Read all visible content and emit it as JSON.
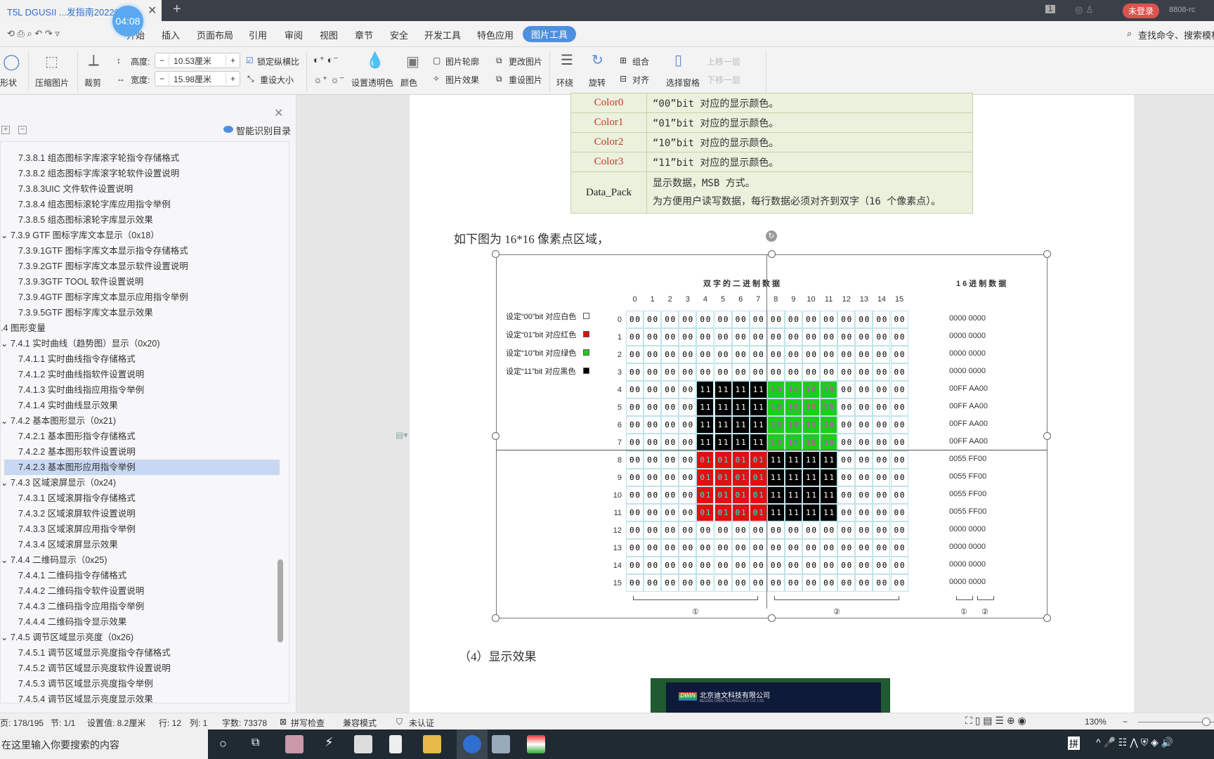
{
  "window": {
    "tab_title": "T5L DGUSII ...发指南20220",
    "timer": "04:08",
    "page_num_badge": "1",
    "login": "未登录",
    "version": "8808-rc"
  },
  "menu": {
    "items": [
      "开始",
      "插入",
      "页面布局",
      "引用",
      "审阅",
      "视图",
      "章节",
      "安全",
      "开发工具",
      "特色应用",
      "图片工具"
    ],
    "active": "图片工具",
    "search": "查找命令、搜索模板"
  },
  "ribbon": {
    "shape": "形状",
    "compress": "压缩图片",
    "crop": "裁剪",
    "height_label": "高度:",
    "height_value": "10.53厘米",
    "width_label": "宽度:",
    "width_value": "15.98厘米",
    "lock_ratio": "锁定纵横比",
    "reset_size": "重设大小",
    "transparent": "设置透明色",
    "color": "颜色",
    "outline": "图片轮廓",
    "effect": "图片效果",
    "change": "更改图片",
    "reset_pic": "重设图片",
    "wrap": "环绕",
    "rotate": "旋转",
    "group": "组合",
    "align": "对齐",
    "select_pane": "选择窗格",
    "bring_forward": "上移一层",
    "send_backward": "下移一层"
  },
  "sidebar": {
    "smart_toc": "智能识别目录",
    "items": [
      {
        "t": "7.3.8.1 组态图标字库滚字轮指令存储格式",
        "l": 2
      },
      {
        "t": "7.3.8.2 组态图标字库滚字轮软件设置说明",
        "l": 2
      },
      {
        "t": "7.3.8.3UIC 文件软件设置说明",
        "l": 2
      },
      {
        "t": "7.3.8.4 组态图标滚轮字库应用指令举例",
        "l": 2
      },
      {
        "t": "7.3.8.5 组态图标滚轮字库显示效果",
        "l": 2
      },
      {
        "t": "7.3.9 GTF 图标字库文本显示（0x18）",
        "l": 1
      },
      {
        "t": "7.3.9.1GTF 图标字库文本显示指令存储格式",
        "l": 2
      },
      {
        "t": "7.3.9.2GTF 图标字库文本显示软件设置说明",
        "l": 2
      },
      {
        "t": "7.3.9.3GTF TOOL 软件设置说明",
        "l": 2
      },
      {
        "t": "7.3.9.4GTF 图标字库文本显示应用指令举例",
        "l": 2
      },
      {
        "t": "7.3.9.5GTF 图标字库文本显示效果",
        "l": 2
      },
      {
        "t": ".4  图形变量",
        "l": 0
      },
      {
        "t": "7.4.1 实时曲线（趋势图）显示（0x20)",
        "l": 1
      },
      {
        "t": "7.4.1.1  实时曲线指令存储格式",
        "l": 2
      },
      {
        "t": "7.4.1.2 实时曲线指软件设置说明",
        "l": 2
      },
      {
        "t": "7.4.1.3 实时曲线指应用指令举例",
        "l": 2
      },
      {
        "t": "7.4.1.4 实时曲线显示效果",
        "l": 2
      },
      {
        "t": "7.4.2 基本图形显示（0x21)",
        "l": 1
      },
      {
        "t": "7.4.2.1 基本图形指令存储格式",
        "l": 2
      },
      {
        "t": "7.4.2.2 基本图形软件设置说明",
        "l": 2
      },
      {
        "t": "7.4.2.3  基本图形应用指令举例",
        "l": 2,
        "selected": true
      },
      {
        "t": "7.4.3 区域滚屏显示（0x24)",
        "l": 1
      },
      {
        "t": "7.4.3.1 区域滚屏指令存储格式",
        "l": 2
      },
      {
        "t": "7.4.3.2 区域滚屏软件设置说明",
        "l": 2
      },
      {
        "t": "7.4.3.3 区域滚屏应用指令举例",
        "l": 2
      },
      {
        "t": "7.4.3.4 区域滚屏显示效果",
        "l": 2
      },
      {
        "t": "7.4.4 二维码显示（0x25)",
        "l": 1
      },
      {
        "t": "7.4.4.1 二维码指令存储格式",
        "l": 2
      },
      {
        "t": "7.4.4.2 二维码指令软件设置说明",
        "l": 2
      },
      {
        "t": "7.4.4.3 二维码指令应用指令举例",
        "l": 2
      },
      {
        "t": "7.4.4.4 二维码指令显示效果",
        "l": 2
      },
      {
        "t": "7.4.5 调节区域显示亮度（0x26)",
        "l": 1
      },
      {
        "t": "7.4.5.1 调节区域显示亮度指令存储格式",
        "l": 2
      },
      {
        "t": "7.4.5.2 调节区域显示亮度软件设置说明",
        "l": 2
      },
      {
        "t": "7.4.5.3 调节区域显示亮度指令举例",
        "l": 2
      },
      {
        "t": "7.4.5.4 调节区域显示亮度显示效果",
        "l": 2
      }
    ]
  },
  "doc": {
    "params": [
      {
        "name": "Color0",
        "desc": "“00”bit 对应的显示颜色。"
      },
      {
        "name": "Color1",
        "desc": "“01”bit 对应的显示颜色。"
      },
      {
        "name": "Color2",
        "desc": "“10”bit 对应的显示颜色。"
      },
      {
        "name": "Color3",
        "desc": "“11”bit 对应的显示颜色。"
      }
    ],
    "datapack_name": "Data_Pack",
    "datapack_line1": "显示数据，MSB 方式。",
    "datapack_line2": "为方便用户读写数据，每行数据必须对齐到双字（16 个像素点）。",
    "intro": "如下图为 16*16 像素点区域，",
    "section4": "（4）显示效果",
    "photo_company": "北京迪文科技有限公司",
    "photo_company_en": "BEIJING DWIN TECHNOLOGY CO. LTD",
    "photo_logo": "DWIN"
  },
  "figure": {
    "bin_title": "双字的二进制数据",
    "hex_title": "16进制数据",
    "legend": [
      {
        "t": "设定“00”bit 对应白色",
        "c": "#ffffff"
      },
      {
        "t": "设定“01”bit 对应红色",
        "c": "#e01010"
      },
      {
        "t": "设定“10”bit 对应绿色",
        "c": "#1ecc1e"
      },
      {
        "t": "设定“11”bit 对应黑色",
        "c": "#000000"
      }
    ],
    "cols": [
      "0",
      "1",
      "2",
      "3",
      "4",
      "5",
      "6",
      "7",
      "8",
      "9",
      "10",
      "11",
      "12",
      "13",
      "14",
      "15"
    ],
    "rows": [
      "0",
      "1",
      "2",
      "3",
      "4",
      "5",
      "6",
      "7",
      "8",
      "9",
      "10",
      "11",
      "12",
      "13",
      "14",
      "15"
    ],
    "grid": [
      "00 00 00 00 00 00 00 00 00 00 00 00 00 00 00 00",
      "00 00 00 00 00 00 00 00 00 00 00 00 00 00 00 00",
      "00 00 00 00 00 00 00 00 00 00 00 00 00 00 00 00",
      "00 00 00 00 00 00 00 00 00 00 00 00 00 00 00 00",
      "00 00 00 00 11 11 11 11 10 10 10 10 00 00 00 00",
      "00 00 00 00 11 11 11 11 10 10 10 10 00 00 00 00",
      "00 00 00 00 11 11 11 11 10 10 10 10 00 00 00 00",
      "00 00 00 00 11 11 11 11 10 10 10 10 00 00 00 00",
      "00 00 00 00 01 01 01 01 11 11 11 11 00 00 00 00",
      "00 00 00 00 01 01 01 01 11 11 11 11 00 00 00 00",
      "00 00 00 00 01 01 01 01 11 11 11 11 00 00 00 00",
      "00 00 00 00 01 01 01 01 11 11 11 11 00 00 00 00",
      "00 00 00 00 00 00 00 00 00 00 00 00 00 00 00 00",
      "00 00 00 00 00 00 00 00 00 00 00 00 00 00 00 00",
      "00 00 00 00 00 00 00 00 00 00 00 00 00 00 00 00",
      "00 00 00 00 00 00 00 00 00 00 00 00 00 00 00 00"
    ],
    "hex": [
      "0000 0000",
      "0000 0000",
      "0000 0000",
      "0000 0000",
      "00FF AA00",
      "00FF AA00",
      "00FF AA00",
      "00FF AA00",
      "0055 FF00",
      "0055 FF00",
      "0055 FF00",
      "0055 FF00",
      "0000 0000",
      "0000 0000",
      "0000 0000",
      "0000 0000"
    ],
    "bracket1": "①",
    "bracket2": "②"
  },
  "status": {
    "page": "页: 178/195",
    "section": "节: 1/1",
    "setting": "设置值: 8.2厘米",
    "row": "行: 12",
    "col": "列: 1",
    "words": "字数: 73378",
    "spell": "拼写检查",
    "compat": "兼容模式",
    "cert": "未认证",
    "zoom": "130%",
    "zoom_fraction": 0.9
  },
  "taskbar": {
    "search": "在这里输入你要搜索的内容",
    "ime": "拼"
  }
}
